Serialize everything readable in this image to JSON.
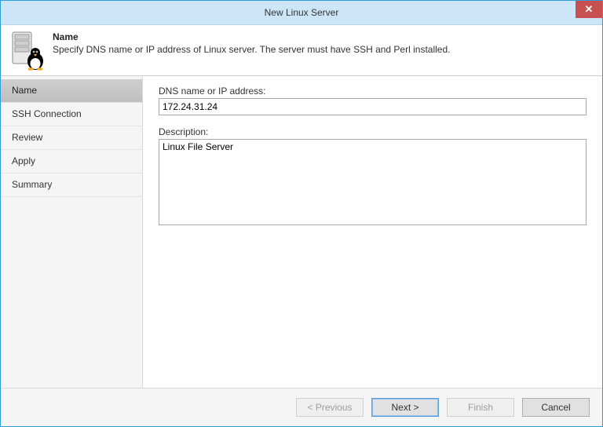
{
  "window": {
    "title": "New Linux Server"
  },
  "header": {
    "title": "Name",
    "description": "Specify DNS name or IP address of Linux server. The server must have SSH and Perl installed."
  },
  "sidebar": {
    "items": [
      {
        "label": "Name",
        "selected": true
      },
      {
        "label": "SSH Connection"
      },
      {
        "label": "Review"
      },
      {
        "label": "Apply"
      },
      {
        "label": "Summary"
      }
    ]
  },
  "form": {
    "dns_label": "DNS name or IP address:",
    "dns_value": "172.24.31.24",
    "desc_label": "Description:",
    "desc_value": "Linux File Server"
  },
  "footer": {
    "previous": "< Previous",
    "next": "Next >",
    "finish": "Finish",
    "cancel": "Cancel"
  }
}
